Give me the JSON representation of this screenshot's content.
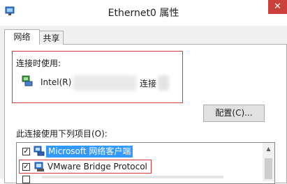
{
  "window": {
    "title": "Ethernet0 属性",
    "close_glyph": "✕",
    "icon": "network-adapter-icon"
  },
  "tabs": [
    {
      "label": "网络",
      "active": true
    },
    {
      "label": "共享",
      "active": false
    }
  ],
  "connection": {
    "label": "连接时使用:",
    "adapter_prefix": "Intel(R)",
    "adapter_suffix": "连接"
  },
  "configure_button": "配置(C)...",
  "items_label": "此连接使用下列项目(O):",
  "items": [
    {
      "checked": true,
      "label": "Microsoft 网络客户端",
      "selected": true,
      "icon": "network-client-icon"
    },
    {
      "checked": true,
      "label": "VMware Bridge Protocol",
      "selected": false,
      "icon": "protocol-icon"
    }
  ],
  "colors": {
    "highlight": "#3399ff",
    "annotation_red": "#d63a3a",
    "close_red": "#c9413a"
  }
}
